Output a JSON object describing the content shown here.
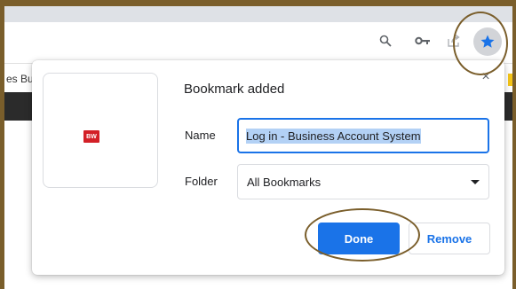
{
  "browser": {
    "bookmarks_bar_fragment": "es Bu",
    "accent": "#1a73e8",
    "annotation_color": "#7a5e2b"
  },
  "toolbar": {
    "icons": [
      "zoom-icon",
      "key-icon",
      "share-icon",
      "bookmark-star-icon"
    ]
  },
  "bookmark_popup": {
    "title": "Bookmark added",
    "thumbnail_logo": "BW",
    "name_label": "Name",
    "name_value": "Log in - Business Account System",
    "folder_label": "Folder",
    "folder_value": "All Bookmarks",
    "done_label": "Done",
    "remove_label": "Remove",
    "close_glyph": "×"
  }
}
